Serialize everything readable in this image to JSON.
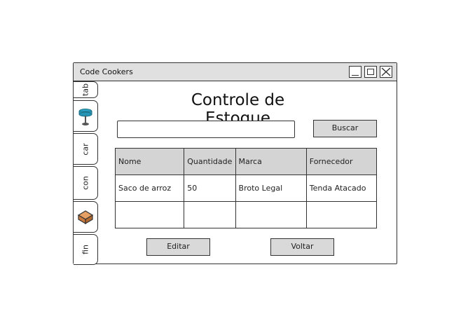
{
  "window": {
    "title": "Code Cookers"
  },
  "tabs": [
    {
      "label": "tab"
    },
    {
      "icon": "stool-icon"
    },
    {
      "label": "car"
    },
    {
      "label": "con"
    },
    {
      "icon": "box-icon"
    },
    {
      "label": "fin"
    }
  ],
  "main": {
    "heading": "Controle de Estoque",
    "search": {
      "value": "",
      "placeholder": ""
    },
    "search_button": "Buscar",
    "table": {
      "columns": [
        "Nome",
        "Quantidade",
        "Marca",
        "Fornecedor"
      ],
      "rows": [
        [
          "Saco de arroz",
          "50",
          "Broto Legal",
          "Tenda Atacado"
        ],
        [
          "",
          "",
          "",
          ""
        ]
      ]
    },
    "edit_button": "Editar",
    "back_button": "Voltar"
  },
  "colors": {
    "titlebar_bg": "#e0e0e0",
    "button_bg": "#d9d9d9",
    "header_bg": "#d4d4d4",
    "stool_accent": "#2aa7c9",
    "box_accent": "#d98a4a"
  }
}
